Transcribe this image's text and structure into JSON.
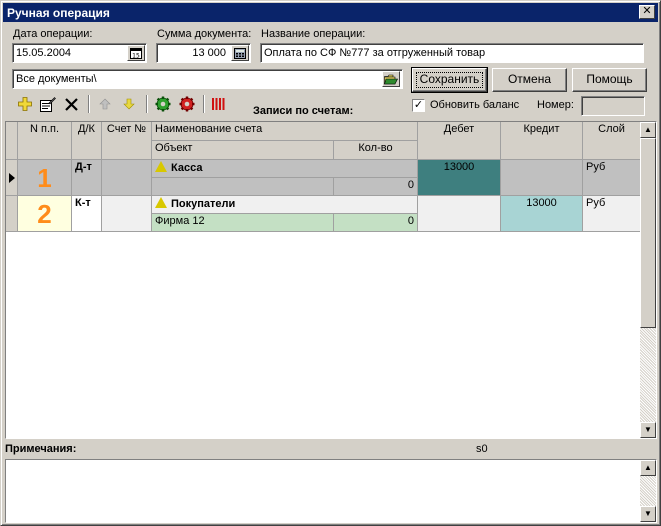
{
  "window": {
    "title": "Ручная операция"
  },
  "form": {
    "date_label": "Дата операции:",
    "date_value": "15.05.2004",
    "sum_label": "Сумма документа:",
    "sum_value": "13 000",
    "name_label": "Название операции:",
    "name_value": "Оплата по СФ №777 за отгруженный товар",
    "docs_value": "Все документы\\"
  },
  "buttons": {
    "save": "Сохранить",
    "cancel": "Отмена",
    "help": "Помощь"
  },
  "toolbar": {
    "section_title": "Записи по счетам:",
    "refresh_label": "Обновить баланс",
    "refresh_checked": "✓",
    "number_label": "Номер:",
    "number_value": ""
  },
  "grid": {
    "headers": {
      "num": "N п.п.",
      "dk": "Д/К",
      "account": "Счет №",
      "account_name": "Наименование счета",
      "object": "Объект",
      "qty": "Кол-во",
      "debit": "Дебет",
      "credit": "Кредит",
      "layer": "Слой"
    },
    "rows": [
      {
        "num": "1",
        "dk": "Д-т",
        "account": "",
        "name": "Касса",
        "object": "",
        "qty": "0",
        "debit": "13000",
        "credit": "",
        "layer": "Руб"
      },
      {
        "num": "2",
        "dk": "К-т",
        "account": "",
        "name": "Покупатели",
        "object": "Фирма 12",
        "qty": "0",
        "debit": "",
        "credit": "13000",
        "layer": "Руб"
      }
    ]
  },
  "notes": {
    "label": "Примечания:",
    "status": "s0",
    "value": ""
  },
  "colors": {
    "title_bar": "#0a246a",
    "debit_selected": "#3e7f7f",
    "credit_cell": "#a8d4d4",
    "object_cell": "#c4e0c4",
    "row_selected": "#c0c0c0"
  }
}
